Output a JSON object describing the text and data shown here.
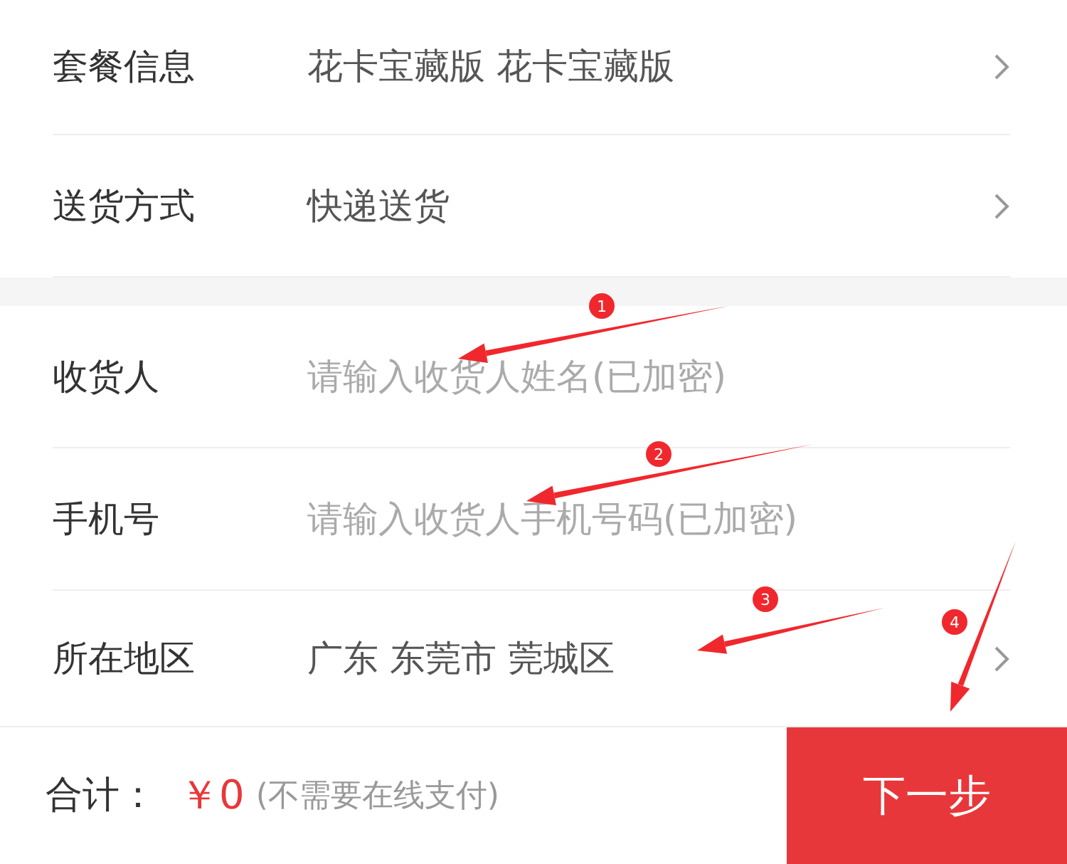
{
  "sections": [
    {
      "rows": [
        {
          "kind": "select",
          "label": "套餐信息",
          "value": "花卡宝藏版 花卡宝藏版"
        },
        {
          "kind": "select",
          "label": "送货方式",
          "value": "快递送货"
        }
      ]
    },
    {
      "rows": [
        {
          "kind": "input",
          "label": "收货人",
          "placeholder": "请输入收货人姓名(已加密)"
        },
        {
          "kind": "input",
          "label": "手机号",
          "placeholder": "请输入收货人手机号码(已加密)"
        },
        {
          "kind": "select",
          "label": "所在地区",
          "value": "广东 东莞市 莞城区"
        }
      ]
    }
  ],
  "footer": {
    "total_label": "合计：",
    "amount": "￥0",
    "note": "(不需要在线支付)",
    "next_button": "下一步"
  },
  "annotations": [
    {
      "label": "1"
    },
    {
      "label": "2"
    },
    {
      "label": "3"
    },
    {
      "label": "4"
    }
  ]
}
